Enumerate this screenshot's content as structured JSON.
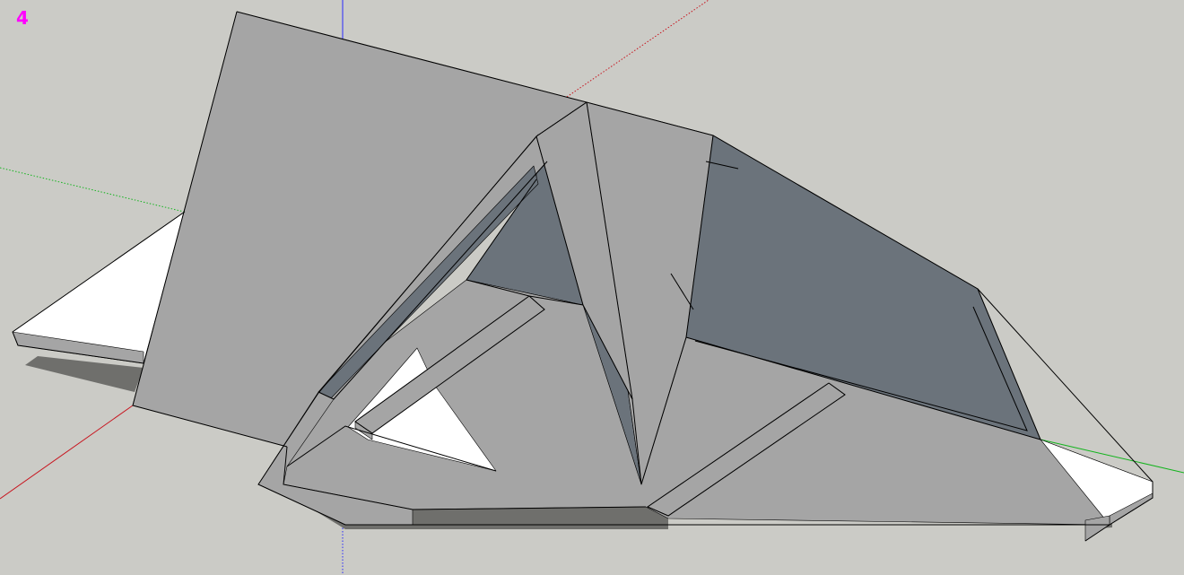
{
  "viewport": {
    "scene_label": "4",
    "label_color": "#ff00ff",
    "background_color": "#cbcbc6"
  },
  "axes": {
    "red_axis_color": "#c8141e",
    "green_axis_color": "#14b41e",
    "blue_axis_color": "#2828ff"
  },
  "model": {
    "face_light_color": "#a5a5a5",
    "face_dark_color": "#6b737b",
    "face_white_color": "#ffffff",
    "shadow_color": "#6f6f6c",
    "edge_color": "#000000"
  }
}
